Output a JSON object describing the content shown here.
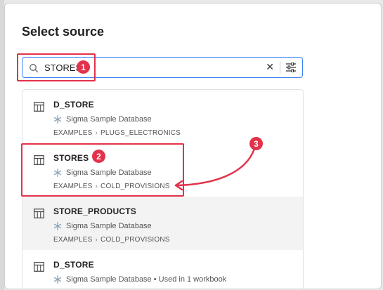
{
  "modal": {
    "title": "Select source"
  },
  "search": {
    "value": "STORES"
  },
  "results": [
    {
      "name": "D_STORE",
      "database": "Sigma Sample Database",
      "path": [
        "EXAMPLES",
        "PLUGS_ELECTRONICS"
      ]
    },
    {
      "name": "STORES",
      "database": "Sigma Sample Database",
      "path": [
        "EXAMPLES",
        "COLD_PROVISIONS"
      ]
    },
    {
      "name": "STORE_PRODUCTS",
      "database": "Sigma Sample Database",
      "path": [
        "EXAMPLES",
        "COLD_PROVISIONS"
      ]
    },
    {
      "name": "D_STORE",
      "database": "Sigma Sample Database • Used in 1 workbook",
      "path": [
        "",
        ""
      ]
    }
  ],
  "annotations": {
    "badge1": "1",
    "badge2": "2",
    "badge3": "3",
    "color": "#e3324a"
  }
}
